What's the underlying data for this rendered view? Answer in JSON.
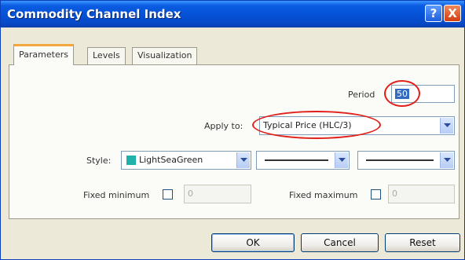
{
  "window": {
    "title": "Commodity Channel Index",
    "help_glyph": "?",
    "close_glyph": "X"
  },
  "tabs": [
    {
      "label": "Parameters",
      "active": true
    },
    {
      "label": "Levels",
      "active": false
    },
    {
      "label": "Visualization",
      "active": false
    }
  ],
  "params": {
    "period_label": "Period",
    "period_value": "50",
    "apply_label": "Apply to:",
    "apply_value": "Typical Price (HLC/3)",
    "style_label": "Style:",
    "style_color_name": "LightSeaGreen",
    "style_color_hex": "#20b2aa",
    "fixed_min_label": "Fixed minimum",
    "fixed_min_value": "0",
    "fixed_max_label": "Fixed maximum",
    "fixed_max_value": "0"
  },
  "buttons": {
    "ok": "OK",
    "cancel": "Cancel",
    "reset": "Reset"
  }
}
